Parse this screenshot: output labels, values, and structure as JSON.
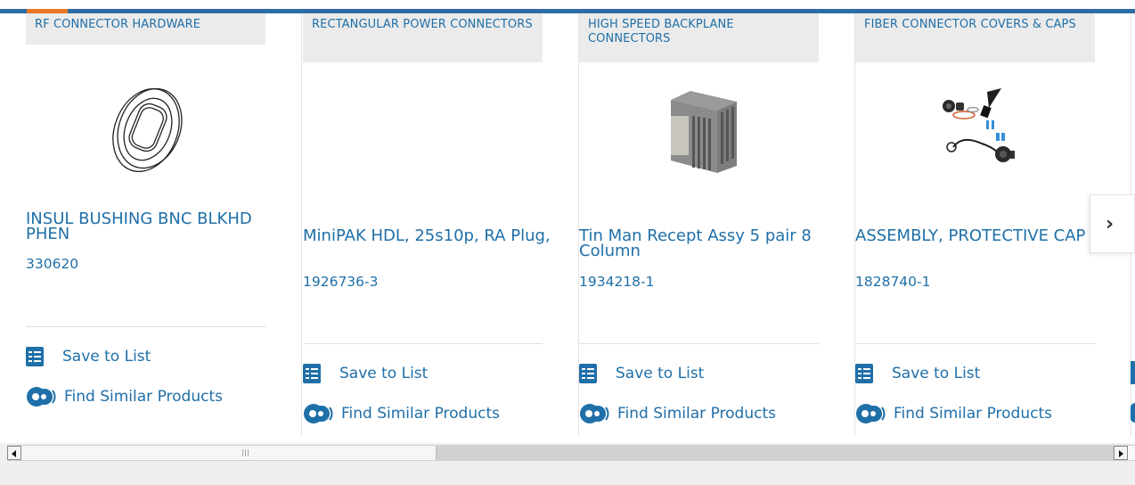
{
  "colors": {
    "link": "#1f6fa8",
    "top_bar": "#2e6da4",
    "accent": "#e87722",
    "category_bg": "#ebebeb"
  },
  "carousel": {
    "next_icon": "chevron-right-icon",
    "cards": [
      {
        "category": "RF CONNECTOR HARDWARE",
        "title": "INSUL BUSHING BNC BLKHD PHEN",
        "part_number": "330620",
        "image": "insulating-bushing-image",
        "save_label": "Save to List",
        "find_label": "Find Similar Products"
      },
      {
        "category": "RECTANGULAR POWER CONNECTORS",
        "title": "MiniPAK HDL, 25s10p, RA Plug,",
        "part_number": "1926736-3",
        "image": "",
        "save_label": "Save to List",
        "find_label": "Find Similar Products"
      },
      {
        "category": "HIGH SPEED BACKPLANE CONNECTORS",
        "title": "Tin Man Recept Assy 5 pair 8 Column",
        "part_number": "1934218-1",
        "image": "backplane-connector-image",
        "save_label": "Save to List",
        "find_label": "Find Similar Products"
      },
      {
        "category": "FIBER CONNECTOR COVERS & CAPS",
        "title": "ASSEMBLY, PROTECTIVE CAP",
        "part_number": "1828740-1",
        "image": "protective-cap-assembly-image",
        "save_label": "Save to List",
        "find_label": "Find Similar Products"
      }
    ]
  },
  "scrollbar": {
    "orientation": "horizontal"
  }
}
